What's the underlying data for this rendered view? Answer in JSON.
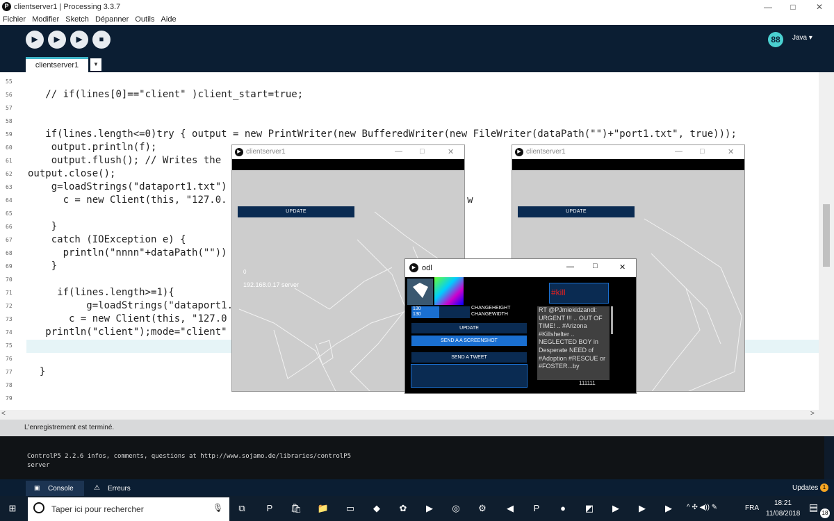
{
  "window": {
    "title": "clientserver1 | Processing 3.3.7",
    "minimize": "—",
    "maximize": "□",
    "close": "✕"
  },
  "menu": [
    "Fichier",
    "Modifier",
    "Sketch",
    "Dépanner",
    "Outils",
    "Aide"
  ],
  "toolbar": {
    "mode": "Java ▾",
    "mode_icon": "88"
  },
  "tabs": {
    "active": "clientserver1",
    "arrow": "▼"
  },
  "editor": {
    "line_numbers": [
      "55",
      "56",
      "57",
      "58",
      "59",
      "60",
      "61",
      "62",
      "63",
      "64",
      "65",
      "66",
      "67",
      "68",
      "69",
      "70",
      "71",
      "72",
      "73",
      "74",
      "75",
      "76",
      "77",
      "78",
      "79"
    ],
    "lines": [
      {
        "indent": "",
        "text": ""
      },
      {
        "indent": "   ",
        "text": "// if(lines[0]==\"client\" )client_start=true;"
      },
      {
        "indent": "",
        "text": ""
      },
      {
        "indent": "",
        "text": ""
      },
      {
        "indent": "   ",
        "text": "if(lines.length<=0)try { output = new PrintWriter(new BufferedWriter(new FileWriter(dataPath(\"\")+\"port1.txt\", true)));"
      },
      {
        "indent": "    ",
        "text": "output.println(f);"
      },
      {
        "indent": "    ",
        "text": "output.flush(); // Writes the"
      },
      {
        "indent": "",
        "text": "output.close();"
      },
      {
        "indent": "    ",
        "text": "g=loadStrings(\"dataport1.txt\")"
      },
      {
        "indent": "      ",
        "text": "c = new Client(this, \"127.0.                                  eplace w"
      },
      {
        "indent": "",
        "text": ""
      },
      {
        "indent": "    ",
        "text": "}"
      },
      {
        "indent": "    ",
        "text": "catch (IOException e) {"
      },
      {
        "indent": "      ",
        "text": "println(\"nnnn\"+dataPath(\"\"))"
      },
      {
        "indent": "    ",
        "text": "}"
      },
      {
        "indent": "",
        "text": ""
      },
      {
        "indent": "     ",
        "text": "if(lines.length>=1){"
      },
      {
        "indent": "          ",
        "text": "g=loadStrings(\"dataport1."
      },
      {
        "indent": "       ",
        "text": "c = new Client(this, \"127.0"
      },
      {
        "indent": "   ",
        "text": "println(\"client\");mode=\"client\""
      },
      {
        "indent": "",
        "text": ""
      },
      {
        "indent": "",
        "text": ""
      },
      {
        "indent": "  ",
        "text": "}"
      },
      {
        "indent": "",
        "text": ""
      },
      {
        "indent": "",
        "text": ""
      }
    ]
  },
  "status": "L'enregistrement est terminé.",
  "console": [
    "ControlP5 2.2.6 infos, comments, questions at http://www.sojamo.de/libraries/controlP5",
    "server"
  ],
  "console_tabs": {
    "console": "Console",
    "errors": "Erreurs",
    "updates": "Updates",
    "updates_count": "1"
  },
  "sketch1": {
    "title": "clientserver1",
    "update": "UPDATE",
    "ip": "192.168.0.17 server",
    "zero": "0"
  },
  "sketch2": {
    "title": "clientserver1",
    "update": "UPDATE"
  },
  "odl": {
    "title": "odl",
    "val1": "130",
    "val2": "130",
    "changeheight": "CHANGEHEIGHT",
    "changewidth": "CHANGEWIDTH",
    "update": "UPDATE",
    "screenshot": "SEND A A SCREENSHOT",
    "tweet": "SEND A TWEET",
    "hashtag": "#kill",
    "tweet_text": "RT @PJmiekidzandi: URGENT !!! .. OUT OF TIME! .. #Arizona #Killshelter .. NEGLECTED BOY in Desperate NEED of #Adoption #RESCUE or #FOSTER...by",
    "counter": "111111"
  },
  "taskbar": {
    "search": "Taper ici pour rechercher",
    "lang": "FRA",
    "time": "18:21",
    "date": "11/08/2018",
    "notif": "18"
  },
  "colors": {
    "accent": "#41b5c8",
    "ide_dark": "#0b1e33",
    "button_blue": "#0a2b52",
    "button_bright": "#1a6fd0"
  }
}
